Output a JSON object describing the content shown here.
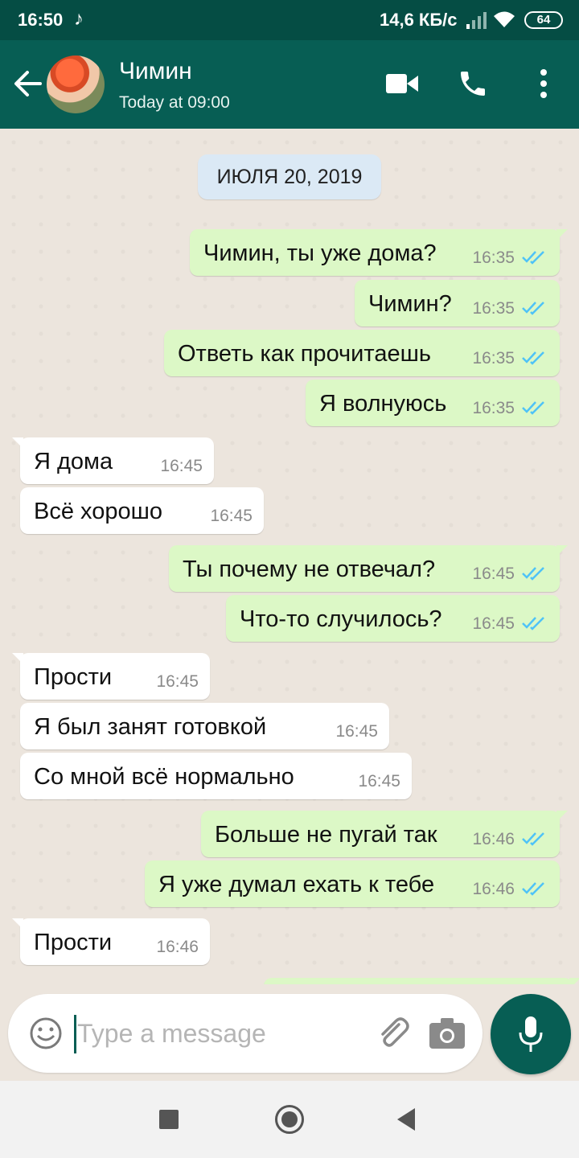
{
  "status_bar": {
    "time": "16:50",
    "music_icon": "♪",
    "speed": "14,6 КБ/с",
    "battery": "64"
  },
  "header": {
    "contact_name": "Чимин",
    "last_seen": "Today at 09:00"
  },
  "chat": {
    "date": "ИЮЛЯ 20, 2019",
    "messages": [
      {
        "dir": "out",
        "text": "Чимин, ты уже дома?",
        "time": "16:35",
        "read": true
      },
      {
        "dir": "out",
        "text": "Чимин?",
        "time": "16:35",
        "read": true
      },
      {
        "dir": "out",
        "text": "Ответь как прочитаешь",
        "time": "16:35",
        "read": true
      },
      {
        "dir": "out",
        "text": "Я волнуюсь",
        "time": "16:35",
        "read": true
      },
      {
        "dir": "in",
        "text": "Я дома",
        "time": "16:45"
      },
      {
        "dir": "in",
        "text": "Всё хорошо",
        "time": "16:45"
      },
      {
        "dir": "out",
        "text": "Ты почему не отвечал?",
        "time": "16:45",
        "read": true
      },
      {
        "dir": "out",
        "text": "Что-то случилось?",
        "time": "16:45",
        "read": true
      },
      {
        "dir": "in",
        "text": "Прости",
        "time": "16:45"
      },
      {
        "dir": "in",
        "text": "Я был занят готовкой",
        "time": "16:45"
      },
      {
        "dir": "in",
        "text": "Со мной всё нормально",
        "time": "16:45"
      },
      {
        "dir": "out",
        "text": "Больше не пугай так",
        "time": "16:46",
        "read": true
      },
      {
        "dir": "out",
        "text": "Я уже думал ехать к тебе",
        "time": "16:46",
        "read": true
      },
      {
        "dir": "in",
        "text": "Прости",
        "time": "16:46"
      }
    ]
  },
  "input": {
    "placeholder": "Type a message"
  },
  "colors": {
    "header": "#075e54",
    "status_bar": "#054d44",
    "outgoing_bubble": "#dcf8c6",
    "incoming_bubble": "#ffffff",
    "chat_background": "#ece5dd",
    "read_ticks": "#4fc3f7"
  },
  "icons": [
    "back-arrow-icon",
    "video-call-icon",
    "phone-icon",
    "more-vert-icon",
    "emoji-icon",
    "attach-icon",
    "camera-icon",
    "mic-icon",
    "double-check-icon"
  ]
}
